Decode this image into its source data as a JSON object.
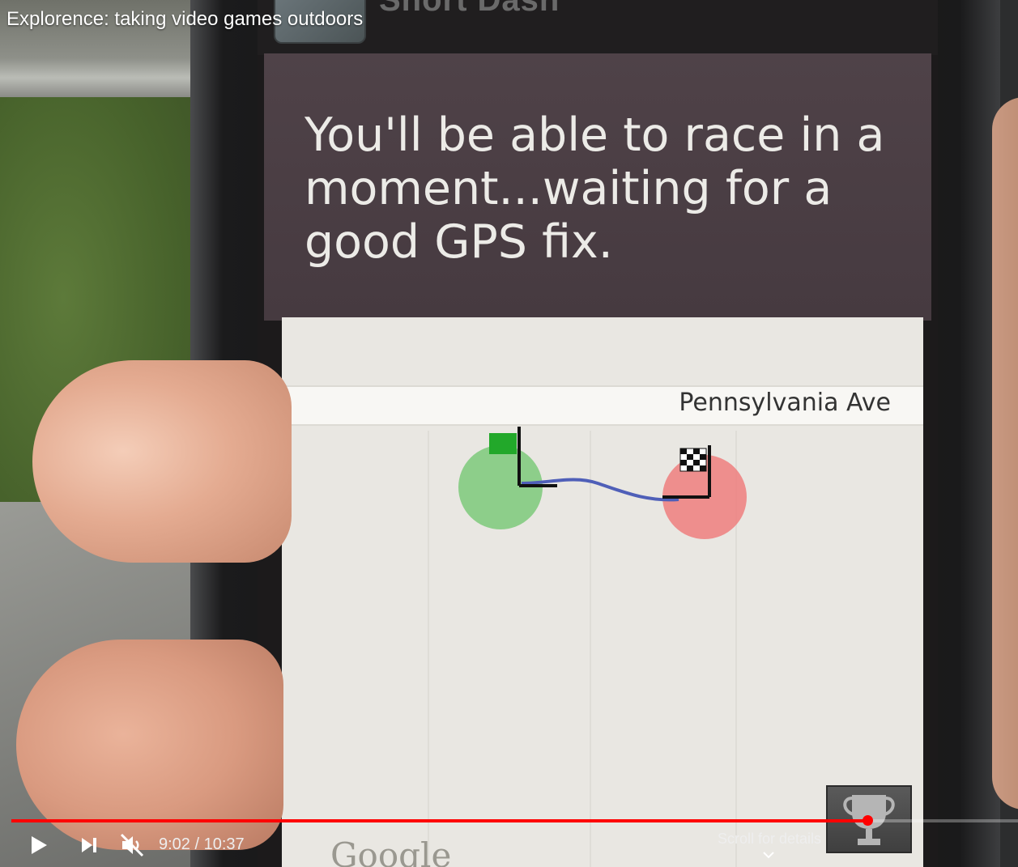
{
  "video": {
    "title": "Explorence: taking video games outdoors",
    "time_current": "9:02",
    "time_total": "10:37",
    "time_separator": "/",
    "progress": 0.85,
    "scroll_hint": "Scroll for details"
  },
  "phone_screen": {
    "app_title": "Short Dash",
    "dialog_message": "You'll be able to race in a moment...waiting for a good GPS fix.",
    "map": {
      "street_label": "Pennsylvania Ave",
      "logo_text": "Google"
    }
  },
  "colors": {
    "progress": "#ff0000",
    "start_marker": "#7cc97a",
    "finish_marker": "#ef7e7e",
    "route_line": "#4f5fb8"
  },
  "icons": {
    "play": "play-icon",
    "next": "next-icon",
    "mute": "volume-muted-icon",
    "scroll": "chevron-down-icon",
    "start_flag": "green-flag-icon",
    "finish_flag": "checkered-flag-icon",
    "trophy": "trophy-icon"
  }
}
